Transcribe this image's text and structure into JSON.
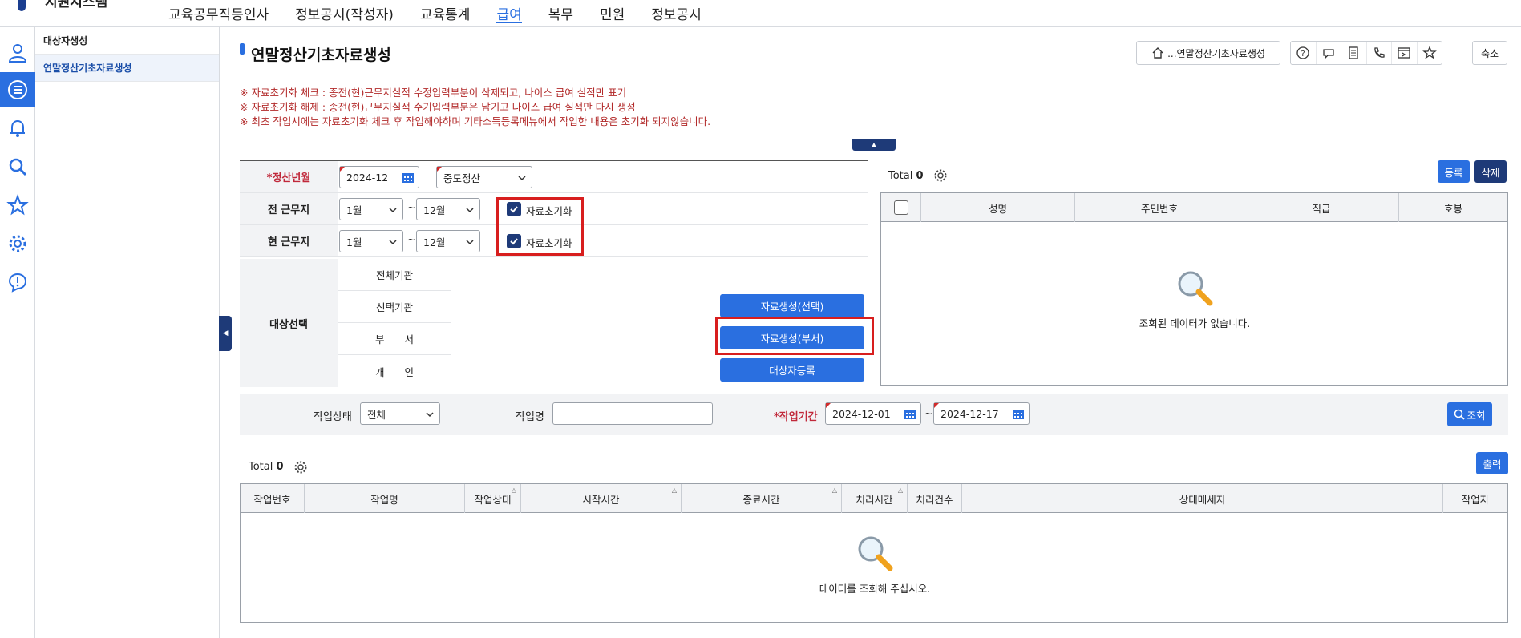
{
  "header": {
    "brand": "지원시스템",
    "nav": [
      "교육공무직등인사",
      "정보공시(작성자)",
      "교육통계",
      "급여",
      "복무",
      "민원",
      "정보공시"
    ],
    "active_nav": "급여"
  },
  "rail_icons": [
    "user-icon",
    "list-icon",
    "bell-icon",
    "search-icon",
    "star-icon",
    "gear-icon",
    "alert-icon"
  ],
  "submenu": {
    "items": [
      {
        "label": "대상자생성",
        "active": false
      },
      {
        "label": "연말정산기초자료생성",
        "active": true
      }
    ]
  },
  "page": {
    "title": "연말정산기초자료생성",
    "breadcrumb": "...연말정산기초자료생성",
    "shrink": "축소",
    "notes": [
      "※ 자료초기화 체크 : 종전(현)근무지실적 수정입력부분이 삭제되고, 나이스 급여 실적만 표기",
      "※ 자료초기화 해제 : 종전(현)근무지실적 수기입력부분은 남기고 나이스 급여 실적만 다시 생성",
      "※ 최초 작업시에는 자료초기화 체크 후 작업해야하며 기타소득등록메뉴에서 작업한 내용은 초기화 되지않습니다."
    ]
  },
  "form": {
    "settlement_label": "*정산년월",
    "settlement_value": "2024-12",
    "settlement_type": "중도정산",
    "prev_work_label": "전 근무지",
    "prev_from": "1월",
    "prev_to": "12월",
    "curr_work_label": "현 근무지",
    "curr_from": "1월",
    "curr_to": "12월",
    "tilde": "~",
    "reset_label": "자료초기화",
    "prev_reset_checked": true,
    "curr_reset_checked": true,
    "target_label": "대상선택",
    "targets": [
      "전체기관",
      "선택기관",
      "부　　서",
      "개　　인"
    ],
    "btn_generate_selected": "자료생성(선택)",
    "btn_generate_dept": "자료생성(부서)",
    "btn_register_target": "대상자등록"
  },
  "right_grid": {
    "total_label": "Total",
    "total_count": "0",
    "btn_register": "등록",
    "btn_delete": "삭제",
    "columns": [
      "성명",
      "주민번호",
      "직급",
      "호봉"
    ],
    "empty_text": "조회된 데이터가 없습니다."
  },
  "search": {
    "status_label": "작업상태",
    "status_value": "전체",
    "name_label": "작업명",
    "name_value": "",
    "period_label": "*작업기간",
    "period_from": "2024-12-01",
    "period_to": "2024-12-17",
    "tilde": "~",
    "btn_search": "조회"
  },
  "bottom_grid": {
    "total_label": "Total",
    "total_count": "0",
    "btn_print": "출력",
    "columns": [
      "작업번호",
      "작업명",
      "작업상태",
      "시작시간",
      "종료시간",
      "처리시간",
      "처리건수",
      "상태메세지",
      "작업자"
    ],
    "empty_text": "데이터를 조회해 주십시오."
  },
  "colors": {
    "accent": "#2a6fe0",
    "navy": "#1e3a78",
    "warning": "#b22a2a",
    "highlight_box": "#d81e1e"
  }
}
